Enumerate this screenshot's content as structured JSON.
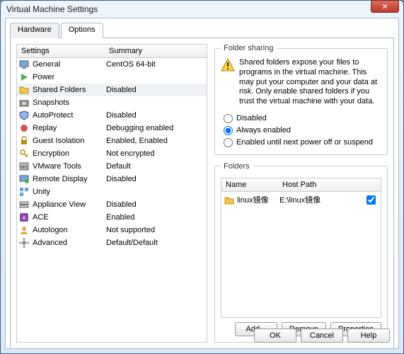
{
  "window": {
    "title": "Virtual Machine Settings"
  },
  "tabs": {
    "hardware": "Hardware",
    "options": "Options",
    "active": "options"
  },
  "columns": {
    "settings": "Settings",
    "summary": "Summary"
  },
  "rows": [
    {
      "name": "General",
      "summary": "CentOS 64-bit",
      "icon": "monitor"
    },
    {
      "name": "Power",
      "summary": "",
      "icon": "play"
    },
    {
      "name": "Shared Folders",
      "summary": "Disabled",
      "icon": "folder",
      "selected": true
    },
    {
      "name": "Snapshots",
      "summary": "",
      "icon": "camera"
    },
    {
      "name": "AutoProtect",
      "summary": "Disabled",
      "icon": "shield"
    },
    {
      "name": "Replay",
      "summary": "Debugging enabled",
      "icon": "record"
    },
    {
      "name": "Guest Isolation",
      "summary": "Enabled, Enabled",
      "icon": "lock"
    },
    {
      "name": "Encryption",
      "summary": "Not encrypted",
      "icon": "key"
    },
    {
      "name": "VMware Tools",
      "summary": "Default",
      "icon": "tools"
    },
    {
      "name": "Remote Display",
      "summary": "Disabled",
      "icon": "remote"
    },
    {
      "name": "Unity",
      "summary": "",
      "icon": "unity"
    },
    {
      "name": "Appliance View",
      "summary": "Disabled",
      "icon": "appliance"
    },
    {
      "name": "ACE",
      "summary": "Enabled",
      "icon": "ace"
    },
    {
      "name": "Autologon",
      "summary": "Not supported",
      "icon": "user"
    },
    {
      "name": "Advanced",
      "summary": "Default/Default",
      "icon": "gear"
    }
  ],
  "sharing": {
    "legend": "Folder sharing",
    "warning": "Shared folders expose your files to programs in the virtual machine. This may put your computer and your data at risk. Only enable shared folders if you trust the virtual machine with your data.",
    "opts": {
      "disabled": "Disabled",
      "always": "Always enabled",
      "until": "Enabled until next power off or suspend"
    },
    "selected": "always"
  },
  "folders": {
    "legend": "Folders",
    "cols": {
      "name": "Name",
      "host": "Host Path"
    },
    "items": [
      {
        "name": "linux镜像",
        "host": "E:\\linux镜像",
        "enabled": true
      }
    ],
    "btns": {
      "add": "Add...",
      "remove": "Remove",
      "props": "Properties"
    }
  },
  "buttons": {
    "ok": "OK",
    "cancel": "Cancel",
    "help": "Help"
  }
}
